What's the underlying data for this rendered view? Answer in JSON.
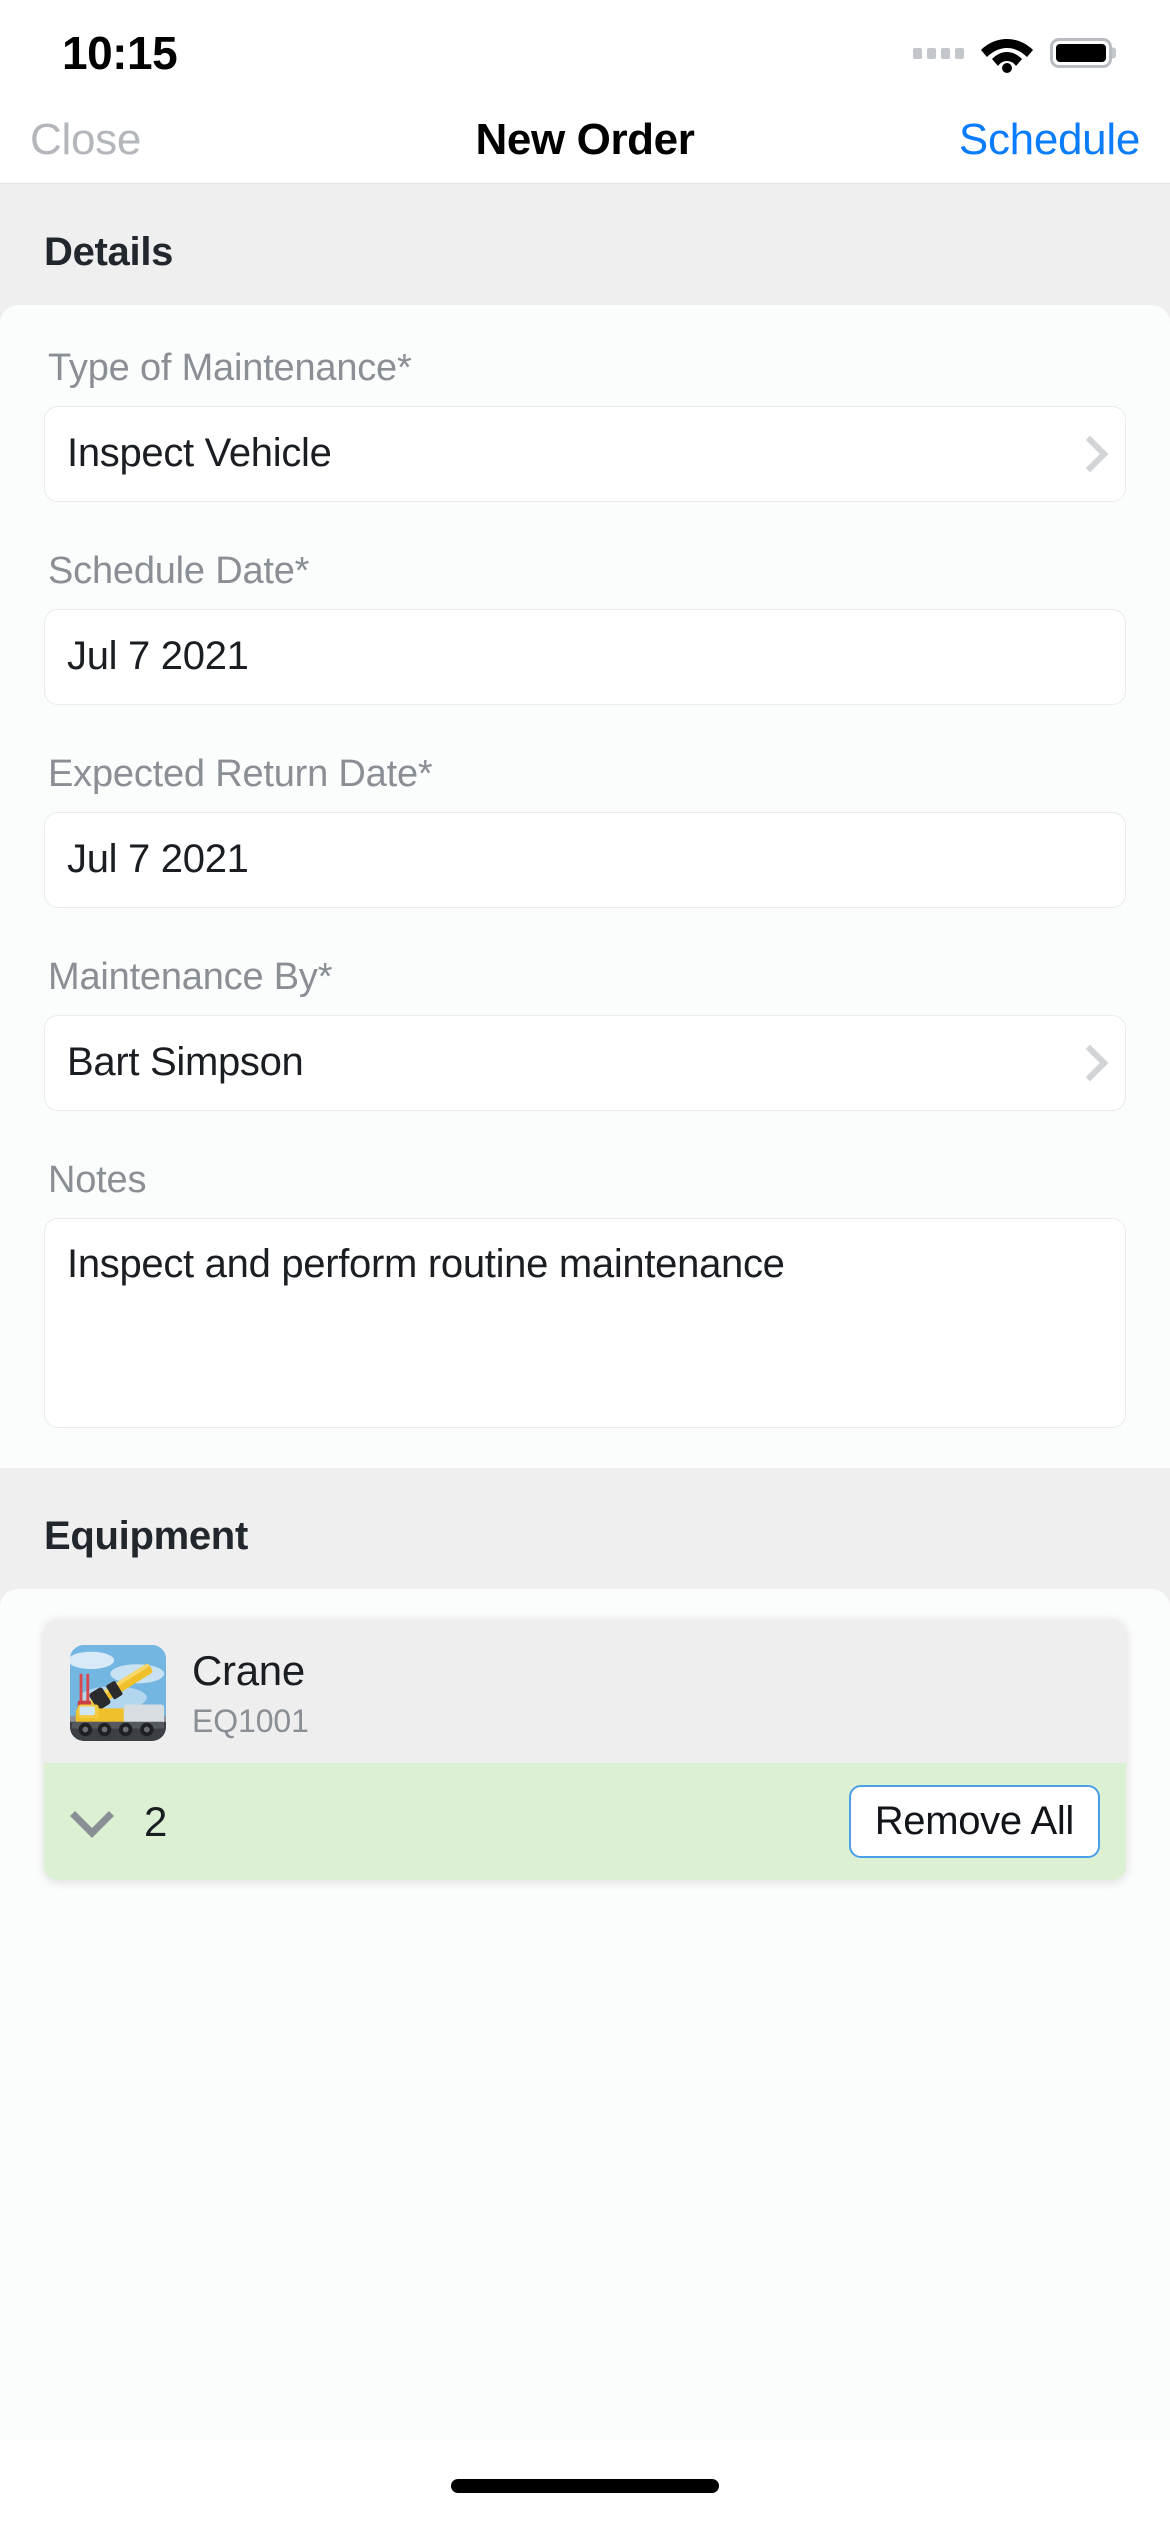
{
  "status_bar": {
    "time": "10:15",
    "signal_icon": "signal-dots-icon",
    "wifi_icon": "wifi-icon",
    "battery_icon": "battery-full-icon"
  },
  "nav": {
    "close_label": "Close",
    "title": "New Order",
    "action_label": "Schedule",
    "action_color": "#0a7cff"
  },
  "details": {
    "section_title": "Details",
    "fields": [
      {
        "label": "Type of Maintenance*",
        "value": "Inspect Vehicle",
        "has_chevron": true
      },
      {
        "label": "Schedule Date*",
        "value": "Jul 7 2021",
        "has_chevron": false
      },
      {
        "label": "Expected Return Date*",
        "value": "Jul 7 2021",
        "has_chevron": false
      },
      {
        "label": "Maintenance By*",
        "value": "Bart Simpson",
        "has_chevron": true
      }
    ],
    "notes": {
      "label": "Notes",
      "value": "Inspect and perform routine maintenance"
    }
  },
  "equipment": {
    "section_title": "Equipment",
    "item": {
      "thumbnail_icon": "crane-photo",
      "name": "Crane",
      "code": "EQ1001",
      "expand_icon": "chevron-down-icon",
      "quantity": "2",
      "remove_label": "Remove All",
      "footer_color": "#dcf0d4",
      "remove_border_color": "#4a9eea"
    }
  }
}
